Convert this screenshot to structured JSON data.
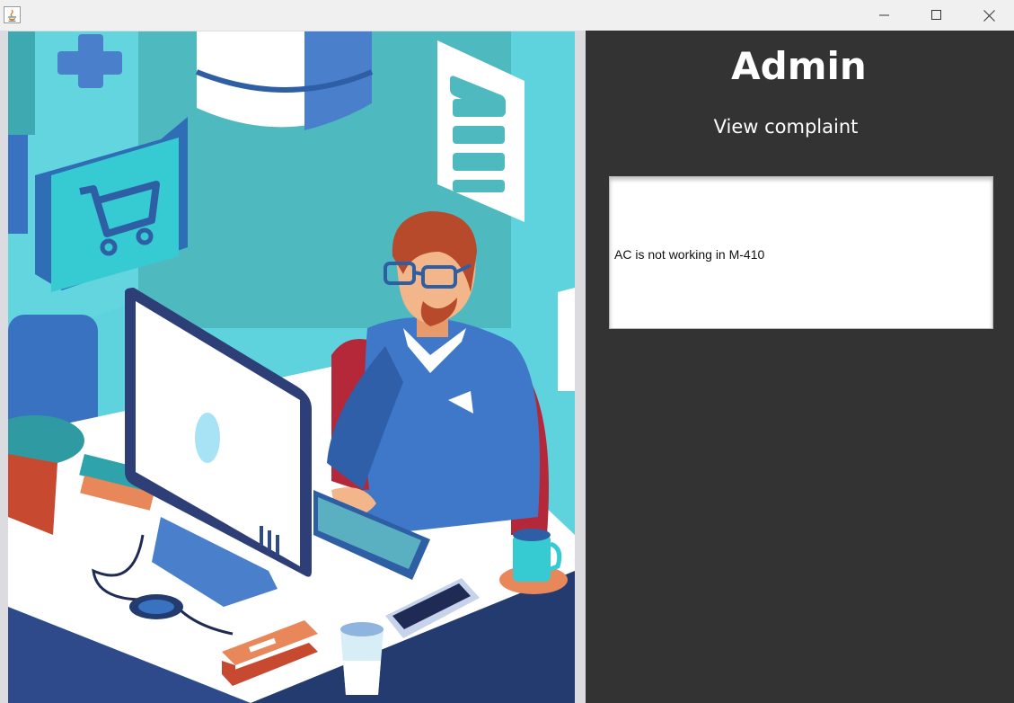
{
  "window": {
    "title": "",
    "controls": [
      "minimize-icon",
      "maximize-icon",
      "close-icon"
    ]
  },
  "admin": {
    "title": "Admin",
    "subtitle": "View complaint",
    "complaint_text": "AC is not working in M-410"
  },
  "colors": {
    "panel_bg": "#333333",
    "illustration_bg": "#5fd3dd",
    "text": "#ffffff"
  }
}
